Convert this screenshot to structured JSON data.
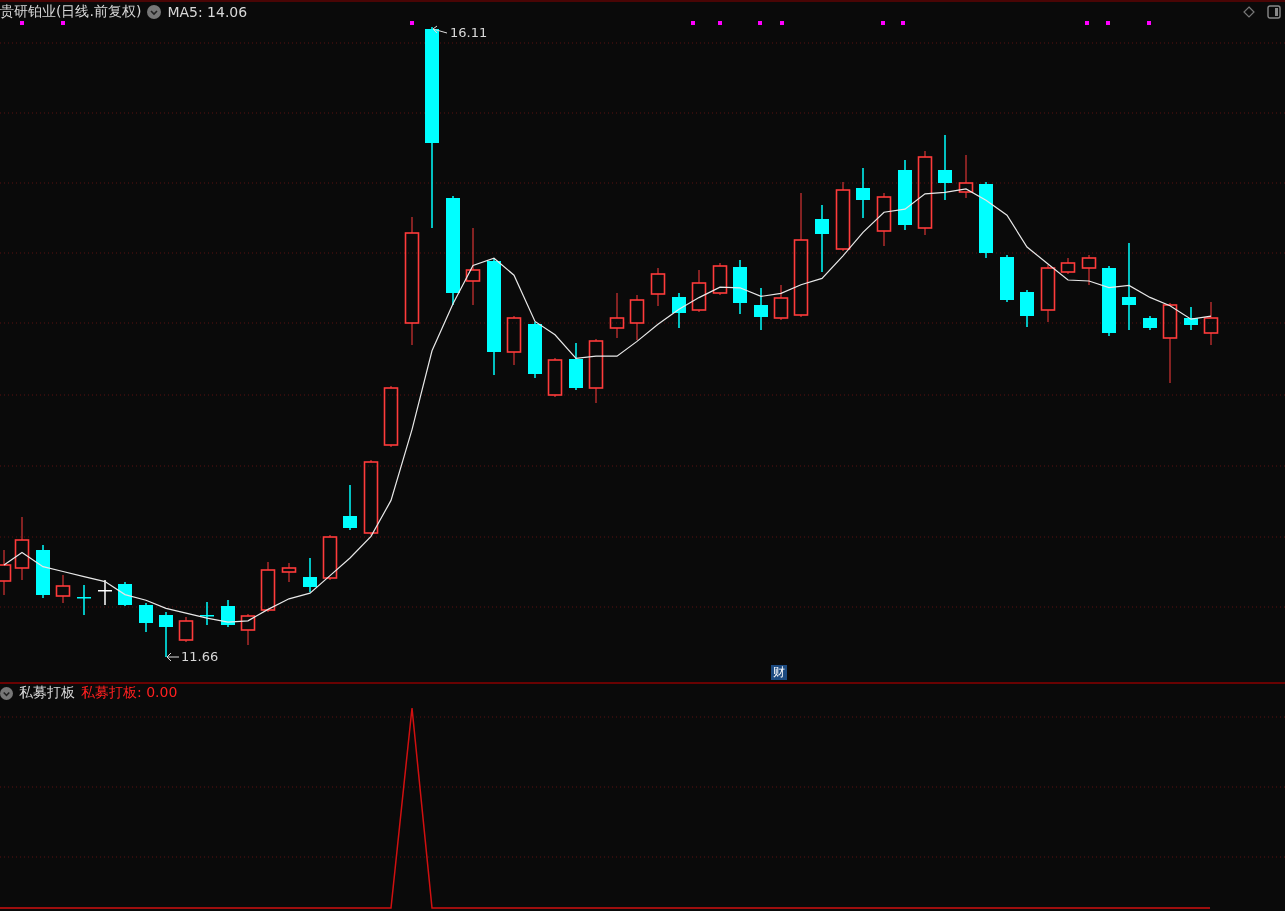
{
  "header": {
    "title": "贵研铂业(日线.前复权)",
    "ma_reading": "MA5: 14.06"
  },
  "main_chart": {
    "high_label": "16.11",
    "low_label": "11.66",
    "badge": "财"
  },
  "indicator": {
    "name": "私募打板",
    "reading": "私募打板: 0.00"
  }
}
